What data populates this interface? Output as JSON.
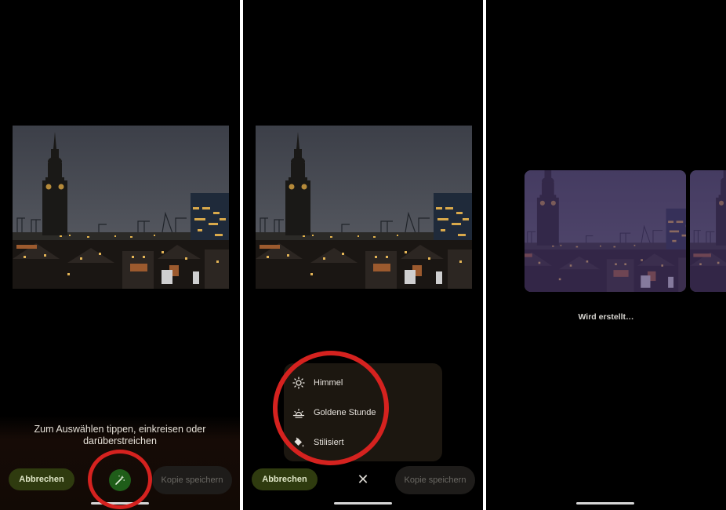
{
  "screen1": {
    "hint": "Zum Auswählen tippen, einkreisen oder darüberstreichen",
    "cancel_label": "Abbrechen",
    "save_copy_label": "Kopie speichern"
  },
  "screen2": {
    "cancel_label": "Abbrechen",
    "save_copy_label": "Kopie speichern",
    "menu": [
      {
        "label": "Himmel",
        "icon": "sun-icon"
      },
      {
        "label": "Goldene Stunde",
        "icon": "sunrise-icon"
      },
      {
        "label": "Stilisiert",
        "icon": "paint-bucket-icon"
      }
    ]
  },
  "screen3": {
    "status": "Wird erstellt…"
  },
  "colors": {
    "annotation_ring": "#d5221f",
    "magic_button": "#1f5d19",
    "cancel_button": "#2f3b0f"
  }
}
